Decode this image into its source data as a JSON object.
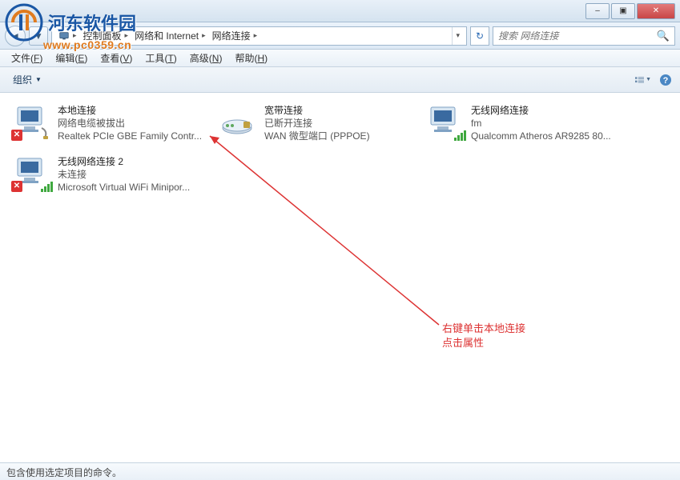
{
  "watermark": {
    "title": "河东软件园",
    "url": "www.pc0359.cn"
  },
  "titlebar": {
    "min": "–",
    "max": "▣",
    "close": "✕"
  },
  "nav": {
    "back": "◄",
    "fwd": "▼",
    "refresh": "↻"
  },
  "breadcrumb": {
    "icon": "🖧",
    "segs": [
      "控制面板",
      "网络和 Internet",
      "网络连接"
    ]
  },
  "search": {
    "placeholder": "搜索 网络连接",
    "icon": "🔍"
  },
  "menu": {
    "file": {
      "label": "文件",
      "key": "F"
    },
    "edit": {
      "label": "编辑",
      "key": "E"
    },
    "view": {
      "label": "查看",
      "key": "V"
    },
    "tools": {
      "label": "工具",
      "key": "T"
    },
    "advanced": {
      "label": "高级",
      "key": "N"
    },
    "help": {
      "label": "帮助",
      "key": "H"
    }
  },
  "toolbar": {
    "organize": "组织",
    "chev": "▼"
  },
  "connections": [
    {
      "name": "本地连接",
      "status": "网络电缆被拔出",
      "device": "Realtek PCIe GBE Family Contr...",
      "type": "eth",
      "disabled": true
    },
    {
      "name": "宽带连接",
      "status": "已断开连接",
      "device": "WAN 微型端口 (PPPOE)",
      "type": "modem",
      "disabled": false
    },
    {
      "name": "无线网络连接",
      "status": "fm",
      "device": "Qualcomm Atheros AR9285 80...",
      "type": "wifi",
      "disabled": false
    },
    {
      "name": "无线网络连接 2",
      "status": "未连接",
      "device": "Microsoft Virtual WiFi Minipor...",
      "type": "wifi",
      "disabled": true
    }
  ],
  "annotation": {
    "line1": "右键单击本地连接",
    "line2": "点击属性"
  },
  "statusbar": {
    "text": "包含使用选定项目的命令。"
  }
}
